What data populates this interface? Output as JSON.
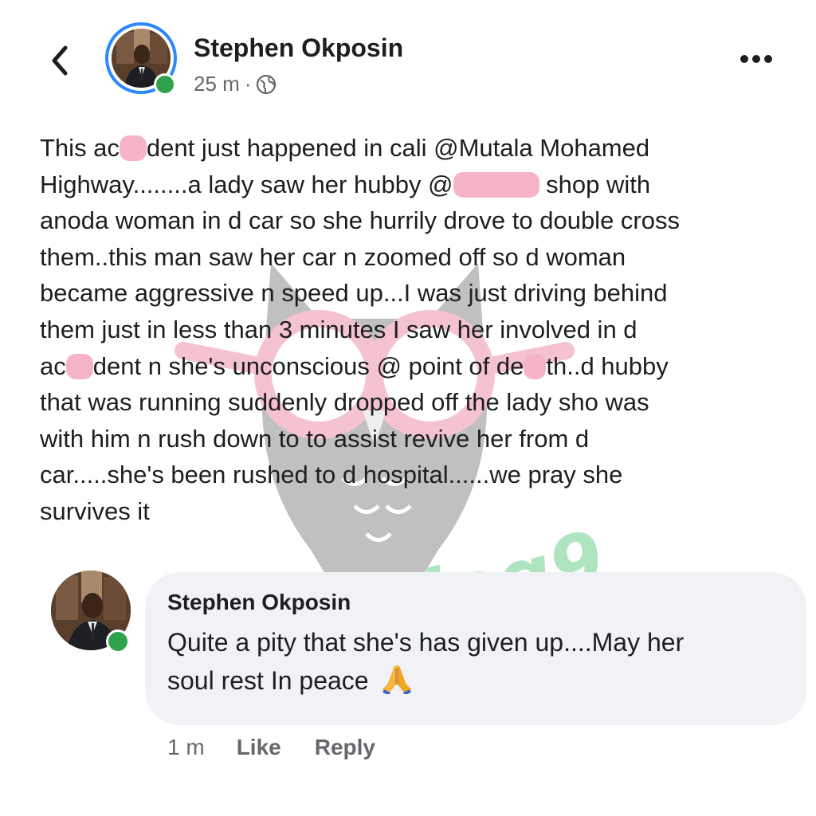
{
  "post": {
    "author": "Stephen Okposin",
    "time": "25 m",
    "separator": "·",
    "privacy_icon": "globe-icon",
    "lines": [
      [
        "This ac",
        "dent just happened in cali @Mutala Mohamed"
      ],
      [
        "Highway........a lady saw her hubby @",
        " shop with"
      ],
      [
        "anoda woman in d car so she hurrily drove to double cross"
      ],
      [
        "them..this man saw her car n zoomed off so d woman"
      ],
      [
        "became aggressive n speed up...I was just driving behind"
      ],
      [
        "them just in less than 3 minutes I saw her involved in d"
      ],
      [
        "ac",
        "dent n she's unconscious @ point of de",
        "th..d hubby"
      ],
      [
        "that was running suddenly dropped off the lady sho was"
      ],
      [
        "with him n rush down to to assist revive her from d"
      ],
      [
        "car.....she's been rushed to d hospital......we pray she"
      ],
      [
        "survives it"
      ]
    ]
  },
  "comment": {
    "author": "Stephen Okposin",
    "lines": [
      "Quite a pity that she's has given up....May her",
      "soul rest In peace "
    ],
    "emoji": "🙏",
    "time": "1 m",
    "like_label": "Like",
    "reply_label": "Reply"
  },
  "watermark": {
    "text": "Instablog9ja"
  },
  "colors": {
    "online": "#31a24c",
    "story_ring": "#2d88ff",
    "redaction": "#f6b5c6",
    "bubble": "#f0f2f5",
    "secondary_text": "#65676b"
  },
  "icons": {
    "back": "chevron-left-icon",
    "more": "more-horizontal-icon",
    "emoji": "folded-hands-emoji"
  }
}
